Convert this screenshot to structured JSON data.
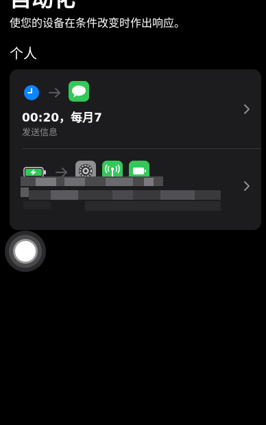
{
  "header": {
    "title": "自动化",
    "subtitle": "使您的设备在条件改变时作出响应。"
  },
  "section": {
    "label": "个人"
  },
  "automations": [
    {
      "trigger_icon": "clock-icon",
      "arrow_icon": "arrow-right-icon",
      "action_icons": [
        "messages-icon"
      ],
      "title": "00:20，每月7",
      "subtitle": "发送信息",
      "chevron_icon": "chevron-right-icon"
    },
    {
      "trigger_icon": "battery-charging-icon",
      "arrow_icon": "arrow-right-icon",
      "action_icons": [
        "settings-icon",
        "cellular-icon",
        "battery-icon"
      ],
      "title": "",
      "subtitle": "",
      "chevron_icon": "chevron-right-icon"
    }
  ],
  "colors": {
    "background": "#000000",
    "card": "#1c1c1e",
    "clock_blue": "#0a84ff",
    "messages_green": "#34c759",
    "secondary_text": "#8e8e93"
  },
  "assistive_touch": {
    "icon": "assistive-touch-icon"
  }
}
